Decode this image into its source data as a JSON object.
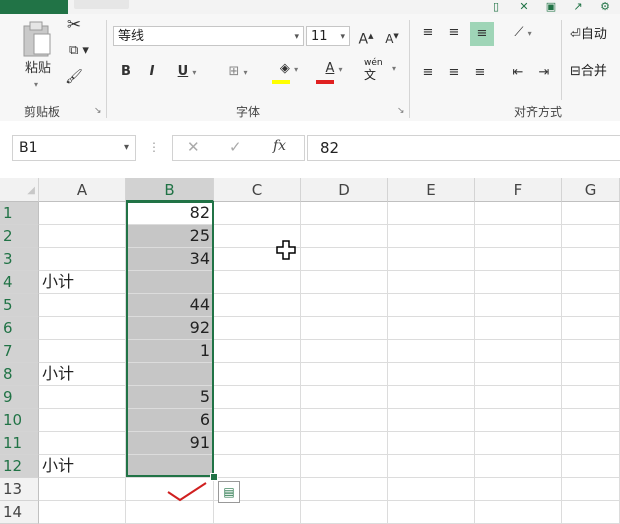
{
  "ribbon": {
    "clipboard": {
      "paste_label": "粘贴",
      "group_label": "剪贴板"
    },
    "font": {
      "font_name": "等线",
      "font_size": "11",
      "grow_label": "A",
      "shrink_label": "A",
      "bold": "B",
      "italic": "I",
      "underline": "U",
      "font_color_label": "A",
      "phonetic_top": "wén",
      "phonetic_bottom": "文",
      "group_label": "字体"
    },
    "alignment": {
      "wrap_label": "自动",
      "merge_label": "合并",
      "group_label": "对齐方式"
    }
  },
  "formula_bar": {
    "name_box": "B1",
    "fx_label": "fx",
    "content": "82"
  },
  "columns": [
    "A",
    "B",
    "C",
    "D",
    "E",
    "F",
    "G"
  ],
  "rows": [
    {
      "num": "1",
      "a": "",
      "b": "82"
    },
    {
      "num": "2",
      "a": "",
      "b": "25"
    },
    {
      "num": "3",
      "a": "",
      "b": "34"
    },
    {
      "num": "4",
      "a": "小计",
      "b": ""
    },
    {
      "num": "5",
      "a": "",
      "b": "44"
    },
    {
      "num": "6",
      "a": "",
      "b": "92"
    },
    {
      "num": "7",
      "a": "",
      "b": "1"
    },
    {
      "num": "8",
      "a": "小计",
      "b": ""
    },
    {
      "num": "9",
      "a": "",
      "b": "5"
    },
    {
      "num": "10",
      "a": "",
      "b": "6"
    },
    {
      "num": "11",
      "a": "",
      "b": "91"
    },
    {
      "num": "12",
      "a": "小计",
      "b": ""
    },
    {
      "num": "13",
      "a": "",
      "b": ""
    },
    {
      "num": "14",
      "a": "",
      "b": ""
    }
  ],
  "selection": {
    "range": "B1:B12",
    "active_cell": "B1"
  },
  "colors": {
    "accent": "#217346",
    "selection_fill": "#c6c6c6",
    "annotation": "#d02020"
  }
}
